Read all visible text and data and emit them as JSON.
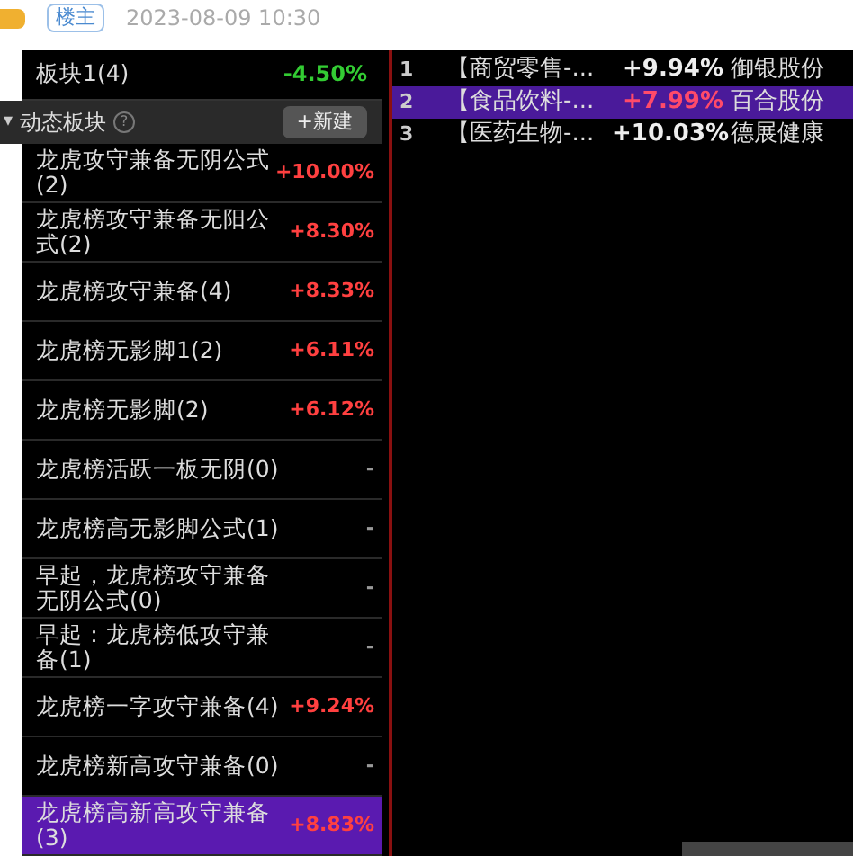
{
  "post_header": {
    "role_tag": "楼主",
    "time": "2023-08-09 10:30"
  },
  "top_block": {
    "name": "板块1(4)",
    "change": "-4.50%",
    "color": "#33cc33"
  },
  "section": {
    "toggle": "▾",
    "title": "动态板块",
    "help": "?",
    "button": "+新建"
  },
  "blocks": [
    {
      "name": "龙虎攻守兼备无阴公式(2)",
      "change": "+10.00%",
      "color": "#ff4040",
      "selected": false
    },
    {
      "name": "龙虎榜攻守兼备无阳公式(2)",
      "change": "+8.30%",
      "color": "#ff4040",
      "selected": false
    },
    {
      "name": "龙虎榜攻守兼备(4)",
      "change": "+8.33%",
      "color": "#ff4040",
      "selected": false
    },
    {
      "name": "龙虎榜无影脚1(2)",
      "change": "+6.11%",
      "color": "#ff4040",
      "selected": false
    },
    {
      "name": "龙虎榜无影脚(2)",
      "change": "+6.12%",
      "color": "#ff4040",
      "selected": false
    },
    {
      "name": "龙虎榜活跃一板无阴(0)",
      "change": "-",
      "color": "#999999",
      "selected": false
    },
    {
      "name": "龙虎榜高无影脚公式(1)",
      "change": "-",
      "color": "#999999",
      "selected": false
    },
    {
      "name": "早起，龙虎榜攻守兼备无阴公式(0)",
      "change": "-",
      "color": "#999999",
      "selected": false
    },
    {
      "name": "早起：龙虎榜低攻守兼备(1)",
      "change": "-",
      "color": "#999999",
      "selected": false
    },
    {
      "name": "龙虎榜一字攻守兼备(4)",
      "change": "+9.24%",
      "color": "#ff4040",
      "selected": false
    },
    {
      "name": "龙虎榜新高攻守兼备(0)",
      "change": "-",
      "color": "#999999",
      "selected": false
    },
    {
      "name": "龙虎榜高新高攻守兼备(3)",
      "change": "+8.83%",
      "color": "#ff4040",
      "selected": true
    }
  ],
  "stocks": [
    {
      "index": "1",
      "sector": "【商贸零售-...",
      "change": "+9.94%",
      "name": "御银股份",
      "selected": false
    },
    {
      "index": "2",
      "sector": "【食品饮料-...",
      "change": "+7.99%",
      "name": "百合股份",
      "selected": true
    },
    {
      "index": "3",
      "sector": "【医药生物-...",
      "change": "+10.03%",
      "name": "德展健康",
      "selected": false
    }
  ]
}
